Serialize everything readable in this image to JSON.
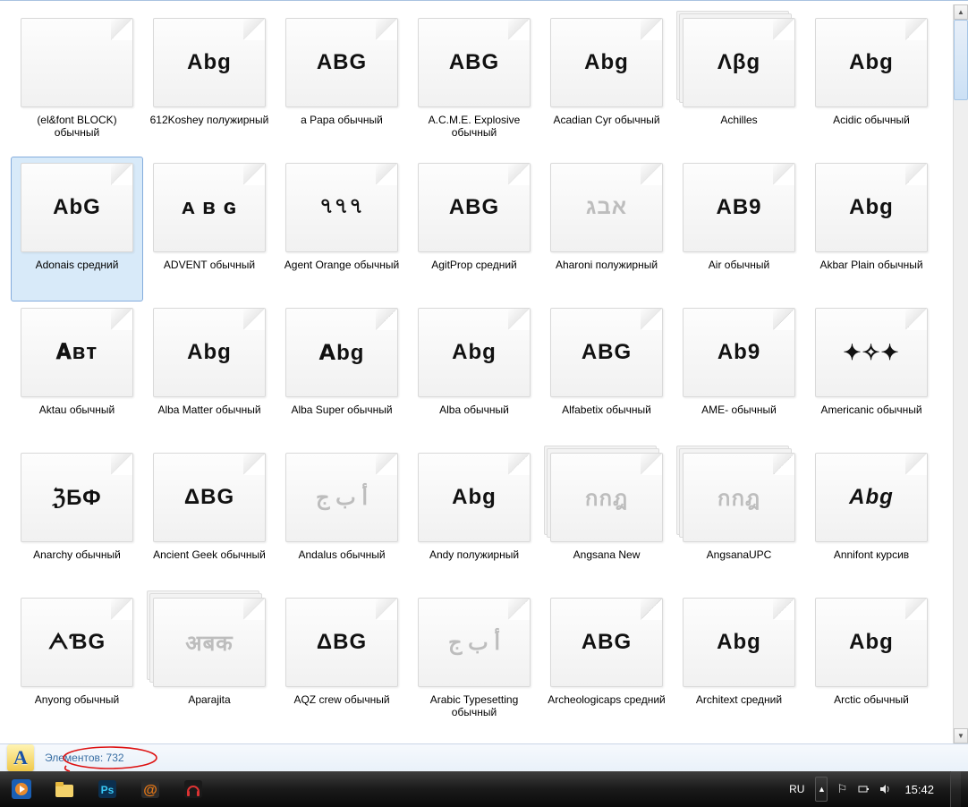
{
  "files": [
    {
      "label": "(el&font BLOCK) обычный",
      "preview": "",
      "stacked": false
    },
    {
      "label": "612Koshey полужирный",
      "preview": "Abg",
      "stacked": false
    },
    {
      "label": "a Papa обычный",
      "preview": "ABG",
      "stacked": false
    },
    {
      "label": "A.C.M.E. Explosive обычный",
      "preview": "ABG",
      "stacked": false
    },
    {
      "label": "Acadian Cyr обычный",
      "preview": "Abg",
      "stacked": false
    },
    {
      "label": "Achilles",
      "preview": "Λβg",
      "stacked": true
    },
    {
      "label": "Acidic обычный",
      "preview": "Abg",
      "stacked": false
    },
    {
      "label": "Adonais средний",
      "preview": "AbG",
      "stacked": false,
      "selected": true
    },
    {
      "label": "ADVENT обычный",
      "preview": "ᴀ ʙ ɢ",
      "stacked": false
    },
    {
      "label": "Agent Orange обычный",
      "preview": "৭৭৭",
      "stacked": false
    },
    {
      "label": "AgitProp средний",
      "preview": "ABG",
      "stacked": false
    },
    {
      "label": "Aharoni полужирный",
      "preview": "אבג",
      "stacked": false,
      "faded": true
    },
    {
      "label": "Air обычный",
      "preview": "AB9",
      "stacked": false
    },
    {
      "label": "Akbar Plain обычный",
      "preview": "Abg",
      "stacked": false
    },
    {
      "label": "Aktau обычный",
      "preview": "𝐀ʙᴛ",
      "stacked": false
    },
    {
      "label": "Alba Matter обычный",
      "preview": "Abg",
      "stacked": false
    },
    {
      "label": "Alba Super обычный",
      "preview": "𝗔bg",
      "stacked": false
    },
    {
      "label": "Alba обычный",
      "preview": "Abg",
      "stacked": false
    },
    {
      "label": "Alfabetix обычный",
      "preview": "ABG",
      "stacked": false
    },
    {
      "label": "AME- обычный",
      "preview": "Ab9",
      "stacked": false
    },
    {
      "label": "Americanic обычный",
      "preview": "✦✧✦",
      "stacked": false
    },
    {
      "label": "Anarchy обычный",
      "preview": "ℨБФ",
      "stacked": false
    },
    {
      "label": "Ancient Geek обычный",
      "preview": "ΔBG",
      "stacked": false
    },
    {
      "label": "Andalus обычный",
      "preview": "أ ب ج",
      "stacked": false,
      "faded": true
    },
    {
      "label": "Andy полужирный",
      "preview": "Abg",
      "stacked": false
    },
    {
      "label": "Angsana New",
      "preview": "กกฎ",
      "stacked": true,
      "faded": true
    },
    {
      "label": "AngsanaUPC",
      "preview": "กกฎ",
      "stacked": true,
      "faded": true
    },
    {
      "label": "Annifont курсив",
      "preview": "Abg",
      "stacked": false,
      "italic": true
    },
    {
      "label": "Anyong обычный",
      "preview": "ᗅƁG",
      "stacked": false
    },
    {
      "label": "Aparajita",
      "preview": "अबक",
      "stacked": true,
      "faded": true
    },
    {
      "label": "AQZ crew обычный",
      "preview": "ΔBG",
      "stacked": false
    },
    {
      "label": "Arabic Typesetting обычный",
      "preview": "أ ب ج",
      "stacked": false,
      "faded": true
    },
    {
      "label": "Archeologicaps средний",
      "preview": "ABG",
      "stacked": false
    },
    {
      "label": "Architext средний",
      "preview": "Abg",
      "stacked": false
    },
    {
      "label": "Arctic обычный",
      "preview": "Abg",
      "stacked": false
    }
  ],
  "status": {
    "label": "Элементов: 732"
  },
  "taskbar": {
    "lang": "RU",
    "time": "15:42"
  }
}
